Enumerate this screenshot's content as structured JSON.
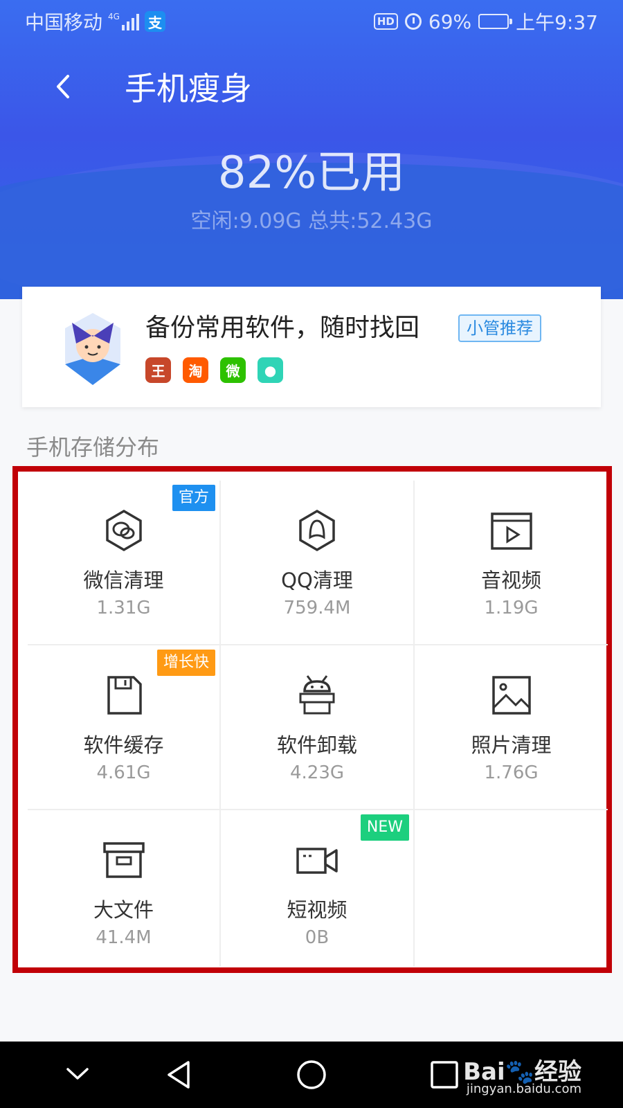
{
  "status_bar": {
    "carrier": "中国移动",
    "network_tag": "4G",
    "alipay_glyph": "支",
    "hd": "HD",
    "battery": "69%",
    "battery_level": 0.69,
    "time": "上午9:37"
  },
  "header": {
    "title": "手机瘦身",
    "used_percent": "82%已用",
    "free_total": "空闲:9.09G 总共:52.43G"
  },
  "backup_card": {
    "title": "备份常用软件，随时找回",
    "badge": "小管推荐",
    "apps": [
      {
        "icon": "game-app-icon",
        "color": "#c7472a",
        "glyph": "王"
      },
      {
        "icon": "taobao-app-icon",
        "color": "#ff5a00",
        "glyph": "淘"
      },
      {
        "icon": "wechat-app-icon",
        "color": "#2dc100",
        "glyph": "微"
      },
      {
        "icon": "panda-app-icon",
        "color": "#2fd4b6",
        "glyph": "●"
      }
    ]
  },
  "storage": {
    "section_label": "手机存储分布",
    "items": [
      {
        "name": "微信清理",
        "size": "1.31G",
        "icon": "wechat-clean-icon",
        "tag": "官方",
        "tag_color": "#1e90f0"
      },
      {
        "name": "QQ清理",
        "size": "759.4M",
        "icon": "qq-clean-icon",
        "tag": "",
        "tag_color": ""
      },
      {
        "name": "音视频",
        "size": "1.19G",
        "icon": "media-icon",
        "tag": "",
        "tag_color": ""
      },
      {
        "name": "软件缓存",
        "size": "4.61G",
        "icon": "cache-icon",
        "tag": "增长快",
        "tag_color": "#ff9a14"
      },
      {
        "name": "软件卸载",
        "size": "4.23G",
        "icon": "uninstall-icon",
        "tag": "",
        "tag_color": ""
      },
      {
        "name": "照片清理",
        "size": "1.76G",
        "icon": "photo-icon",
        "tag": "",
        "tag_color": ""
      },
      {
        "name": "大文件",
        "size": "41.4M",
        "icon": "large-file-icon",
        "tag": "",
        "tag_color": ""
      },
      {
        "name": "短视频",
        "size": "0B",
        "icon": "short-video-icon",
        "tag": "NEW",
        "tag_color": "#1ccf7e"
      }
    ]
  },
  "watermark": {
    "logo": "Bai🐾经验",
    "url": "jingyan.baidu.com"
  }
}
